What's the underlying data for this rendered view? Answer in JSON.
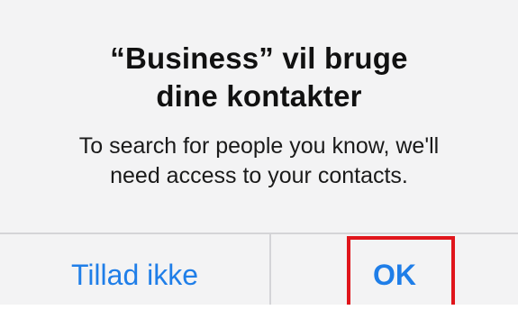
{
  "dialog": {
    "title_lines": [
      "“Business” vil bruge",
      "dine kontakter"
    ],
    "message_lines": [
      "To search for people you know, we'll",
      "need access to your contacts."
    ]
  },
  "buttons": {
    "cancel_label": "Tillad ikke",
    "ok_label": "OK"
  },
  "colors": {
    "alert_background": "#f3f3f4",
    "button_text": "#1f7ee8",
    "divider": "#d4d4d7",
    "highlight_border": "#e0151b"
  }
}
